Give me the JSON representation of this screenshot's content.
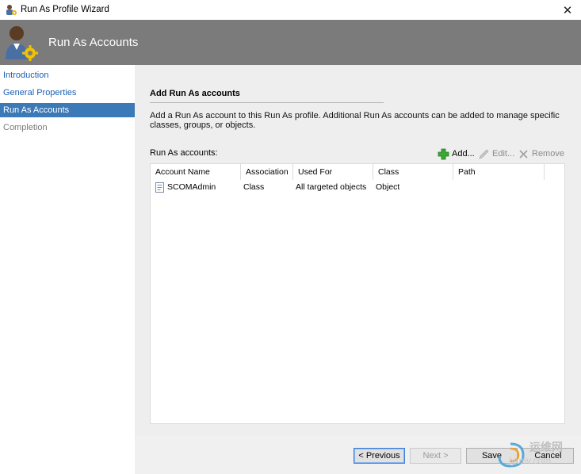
{
  "window": {
    "title": "Run As Profile Wizard"
  },
  "banner": {
    "title": "Run As Accounts"
  },
  "nav": {
    "items": [
      {
        "label": "Introduction",
        "state": "link"
      },
      {
        "label": "General Properties",
        "state": "link"
      },
      {
        "label": "Run As Accounts",
        "state": "selected"
      },
      {
        "label": "Completion",
        "state": "disabled"
      }
    ]
  },
  "content": {
    "section_title": "Add Run As accounts",
    "description": "Add a Run As account to this Run As profile.  Additional Run As accounts can be added to manage specific classes, groups, or objects.",
    "list_label": "Run As accounts:",
    "toolbar": {
      "add": "Add...",
      "edit": "Edit...",
      "remove": "Remove"
    },
    "table": {
      "columns": [
        "Account Name",
        "Association",
        "Used For",
        "Class",
        "Path"
      ],
      "rows": [
        {
          "account_name": "SCOMAdmin",
          "association": "Class",
          "used_for": "All targeted objects",
          "class": "Object",
          "path": ""
        }
      ]
    }
  },
  "footer": {
    "previous": "< Previous",
    "next": "Next >",
    "save": "Save",
    "cancel": "Cancel"
  },
  "watermark": {
    "cn": "运维网",
    "domain": "iyunv.com"
  },
  "colors": {
    "banner": "#7b7b7b",
    "selected_nav": "#3c79b7",
    "link": "#1a5fb4",
    "add_icon": "#3aa832"
  }
}
